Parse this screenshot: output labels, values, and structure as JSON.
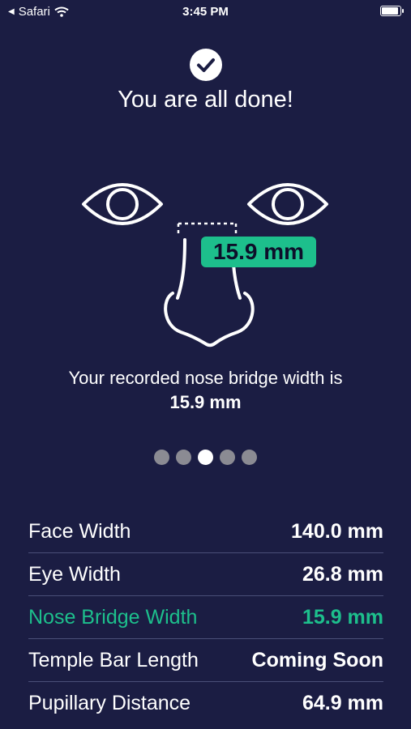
{
  "status_bar": {
    "back_app": "Safari",
    "time": "3:45 PM",
    "battery_level": 1.0
  },
  "header": {
    "icon": "check-circle-icon",
    "title": "You are all done!"
  },
  "illustration": {
    "badge_value": "15.9 mm"
  },
  "result": {
    "text": "Your recorded nose bridge width is",
    "value": "15.9 mm"
  },
  "pagination": {
    "count": 5,
    "active_index": 2
  },
  "measurements": [
    {
      "label": "Face Width",
      "value": "140.0 mm"
    },
    {
      "label": "Eye Width",
      "value": "26.8 mm"
    },
    {
      "label": "Nose Bridge Width",
      "value": "15.9 mm",
      "highlight_color": "#1dbf8c"
    },
    {
      "label": "Temple Bar Length",
      "value": "Coming Soon"
    },
    {
      "label": "Pupillary Distance",
      "value": "64.9 mm"
    }
  ]
}
